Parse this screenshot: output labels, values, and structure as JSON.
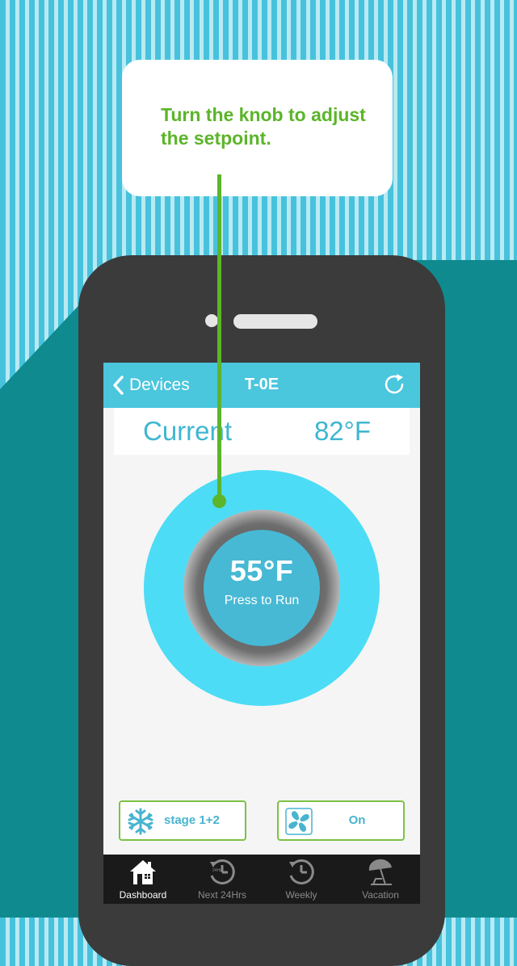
{
  "callout": {
    "text": "Turn the knob to adjust the setpoint."
  },
  "navbar": {
    "back_label": "Devices",
    "title": "T-0E",
    "refresh_icon": "refresh-icon"
  },
  "current": {
    "label": "Current",
    "value": "82°F"
  },
  "knob": {
    "setpoint": "55°F",
    "action_label": "Press to Run"
  },
  "modes": {
    "stage": {
      "label": "stage 1+2",
      "icon": "snowflake-icon"
    },
    "fan": {
      "label": "On",
      "icon": "fan-icon"
    }
  },
  "tabs": [
    {
      "label": "Dashboard",
      "icon": "house-icon",
      "active": true
    },
    {
      "label": "Next 24Hrs",
      "icon": "clock-24hrs-icon",
      "active": false
    },
    {
      "label": "Weekly",
      "icon": "history-clock-icon",
      "active": false
    },
    {
      "label": "Vacation",
      "icon": "beach-umbrella-icon",
      "active": false
    }
  ],
  "colors": {
    "accent": "#4ac6dd",
    "knob": "#4cdcf6",
    "green": "#5cb52a",
    "phone": "#3b3b3b"
  }
}
